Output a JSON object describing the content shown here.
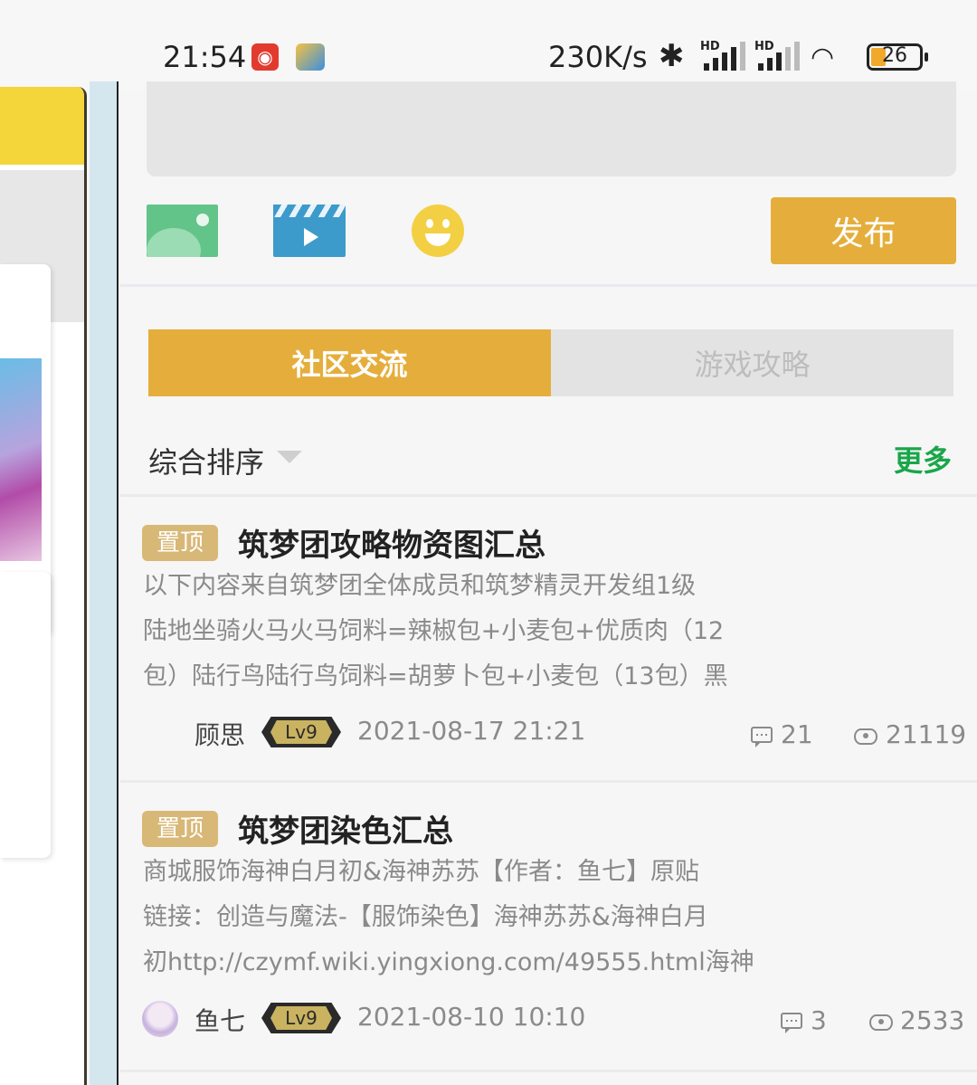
{
  "status_bar": {
    "time": "21:54",
    "speed": "230K/s",
    "hd_label": "HD",
    "battery": "26",
    "icons": [
      "netease-music-icon",
      "app-icon",
      "bluetooth-icon",
      "signal-icon",
      "signal-icon",
      "wifi-icon",
      "battery-icon"
    ]
  },
  "composer": {
    "placeholder": "",
    "publish_label": "发布",
    "icons": [
      "image-icon",
      "video-icon",
      "emoji-icon"
    ]
  },
  "tabs": [
    {
      "label": "社区交流",
      "active": true
    },
    {
      "label": "游戏攻略",
      "active": false
    }
  ],
  "sort": {
    "label": "综合排序",
    "more_label": "更多"
  },
  "colors": {
    "accent": "#e5ae3c",
    "more": "#19a64a",
    "pin": "#d8b877"
  },
  "posts": [
    {
      "pin": "置顶",
      "title": "筑梦团攻略物资图汇总",
      "lines": [
        "以下内容来自筑梦团全体成员和筑梦精灵开发组1级",
        "陆地坐骑火马火马饲料=辣椒包+小麦包+优质肉（12",
        "包）陆行鸟陆行鸟饲料=胡萝卜包+小麦包（13包）黑"
      ],
      "author": "顾思",
      "level": "Lv9",
      "date": "2021-08-17 21:21",
      "comments": "21",
      "views": "21119"
    },
    {
      "pin": "置顶",
      "title": "筑梦团染色汇总",
      "lines": [
        "商城服饰海神白月初&海神苏苏【作者：鱼七】原贴",
        "链接：创造与魔法-【服饰染色】海神苏苏&海神白月",
        "初http://czymf.wiki.yingxiong.com/49555.html海神"
      ],
      "author": "鱼七",
      "level": "Lv9",
      "date": "2021-08-10 10:10",
      "comments": "3",
      "views": "2533"
    }
  ]
}
